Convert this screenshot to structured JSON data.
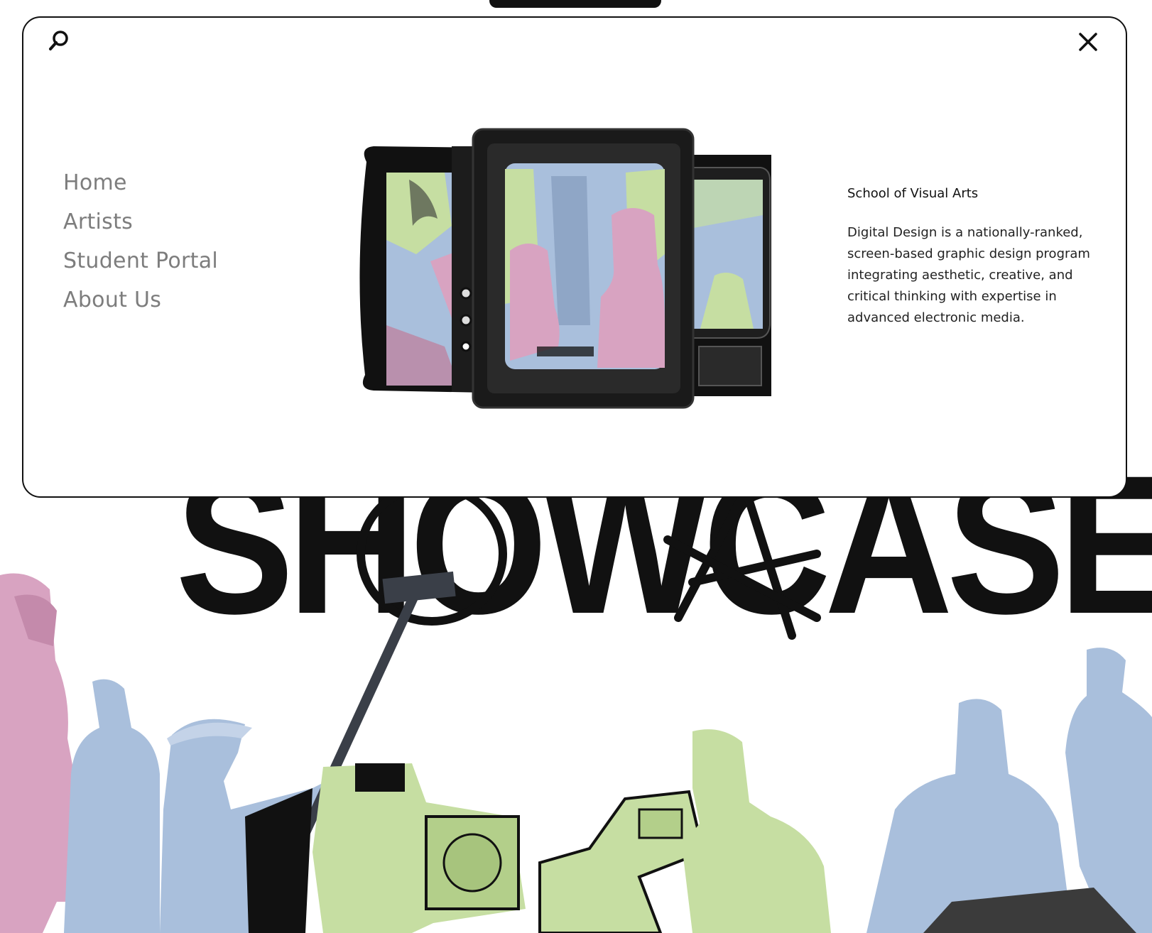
{
  "hero": {
    "headline": "SHOWCASE"
  },
  "menu": {
    "search_icon": "search-icon",
    "close_icon": "close-icon",
    "nav": [
      {
        "label": "Home"
      },
      {
        "label": "Artists"
      },
      {
        "label": "Student Portal"
      },
      {
        "label": "About Us"
      }
    ],
    "school_name": "School of Visual Arts",
    "description": "Digital Design is a nationally-ranked, screen-based graphic design program integrating aesthetic, creative, and critical thinking with expertise in advanced electronic media."
  },
  "colors": {
    "ink": "#111111",
    "nav_text": "#7d7d7d",
    "pink": "#d8a3c1",
    "blue": "#a9bfdc",
    "green": "#c6dea2"
  }
}
